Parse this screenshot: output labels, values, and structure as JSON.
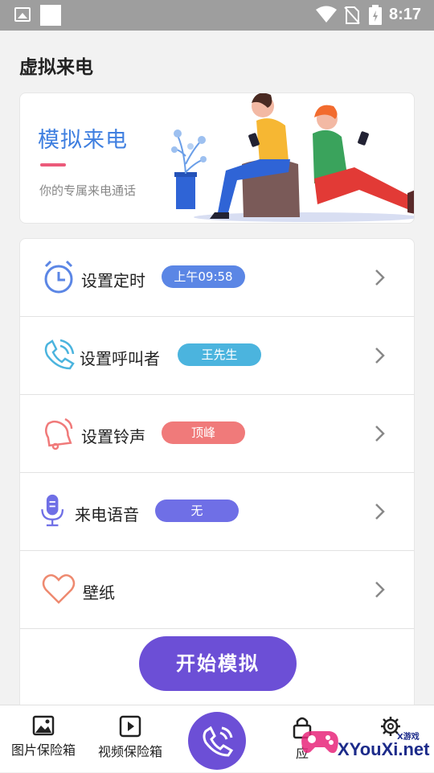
{
  "status_bar": {
    "time": "8:17"
  },
  "page_title": "虚拟来电",
  "banner": {
    "title": "模拟来电",
    "subtitle": "你的专属来电通话"
  },
  "menu": {
    "items": [
      {
        "label": "设置定时",
        "chip": "上午09:58",
        "chip_color": "#5b86e5",
        "icon": "alarm-clock-icon"
      },
      {
        "label": "设置呼叫者",
        "chip": "王先生",
        "chip_color": "#4bb4de",
        "icon": "phone-icon"
      },
      {
        "label": "设置铃声",
        "chip": "顶峰",
        "chip_color": "#f07a7a",
        "icon": "bell-icon"
      },
      {
        "label": "来电语音",
        "chip": "无",
        "chip_color": "#6f6fe6",
        "icon": "microphone-icon"
      },
      {
        "label": "壁纸",
        "icon": "heart-icon"
      }
    ],
    "start_button": "开始模拟"
  },
  "bottom_nav": {
    "items": [
      {
        "label": "图片保险箱",
        "icon": "image-icon"
      },
      {
        "label": "视频保险箱",
        "icon": "video-icon"
      },
      {
        "label": "",
        "icon": "phone-call-icon"
      },
      {
        "label": "应",
        "icon": "lock-icon"
      },
      {
        "label": "",
        "icon": "gear-icon"
      }
    ]
  },
  "watermark": {
    "brand": "XYouXi.net",
    "small": "X游戏"
  },
  "colors": {
    "accent": "#6c4fd6",
    "title_blue": "#3f7fe0",
    "status_bar": "#9e9e9e"
  }
}
